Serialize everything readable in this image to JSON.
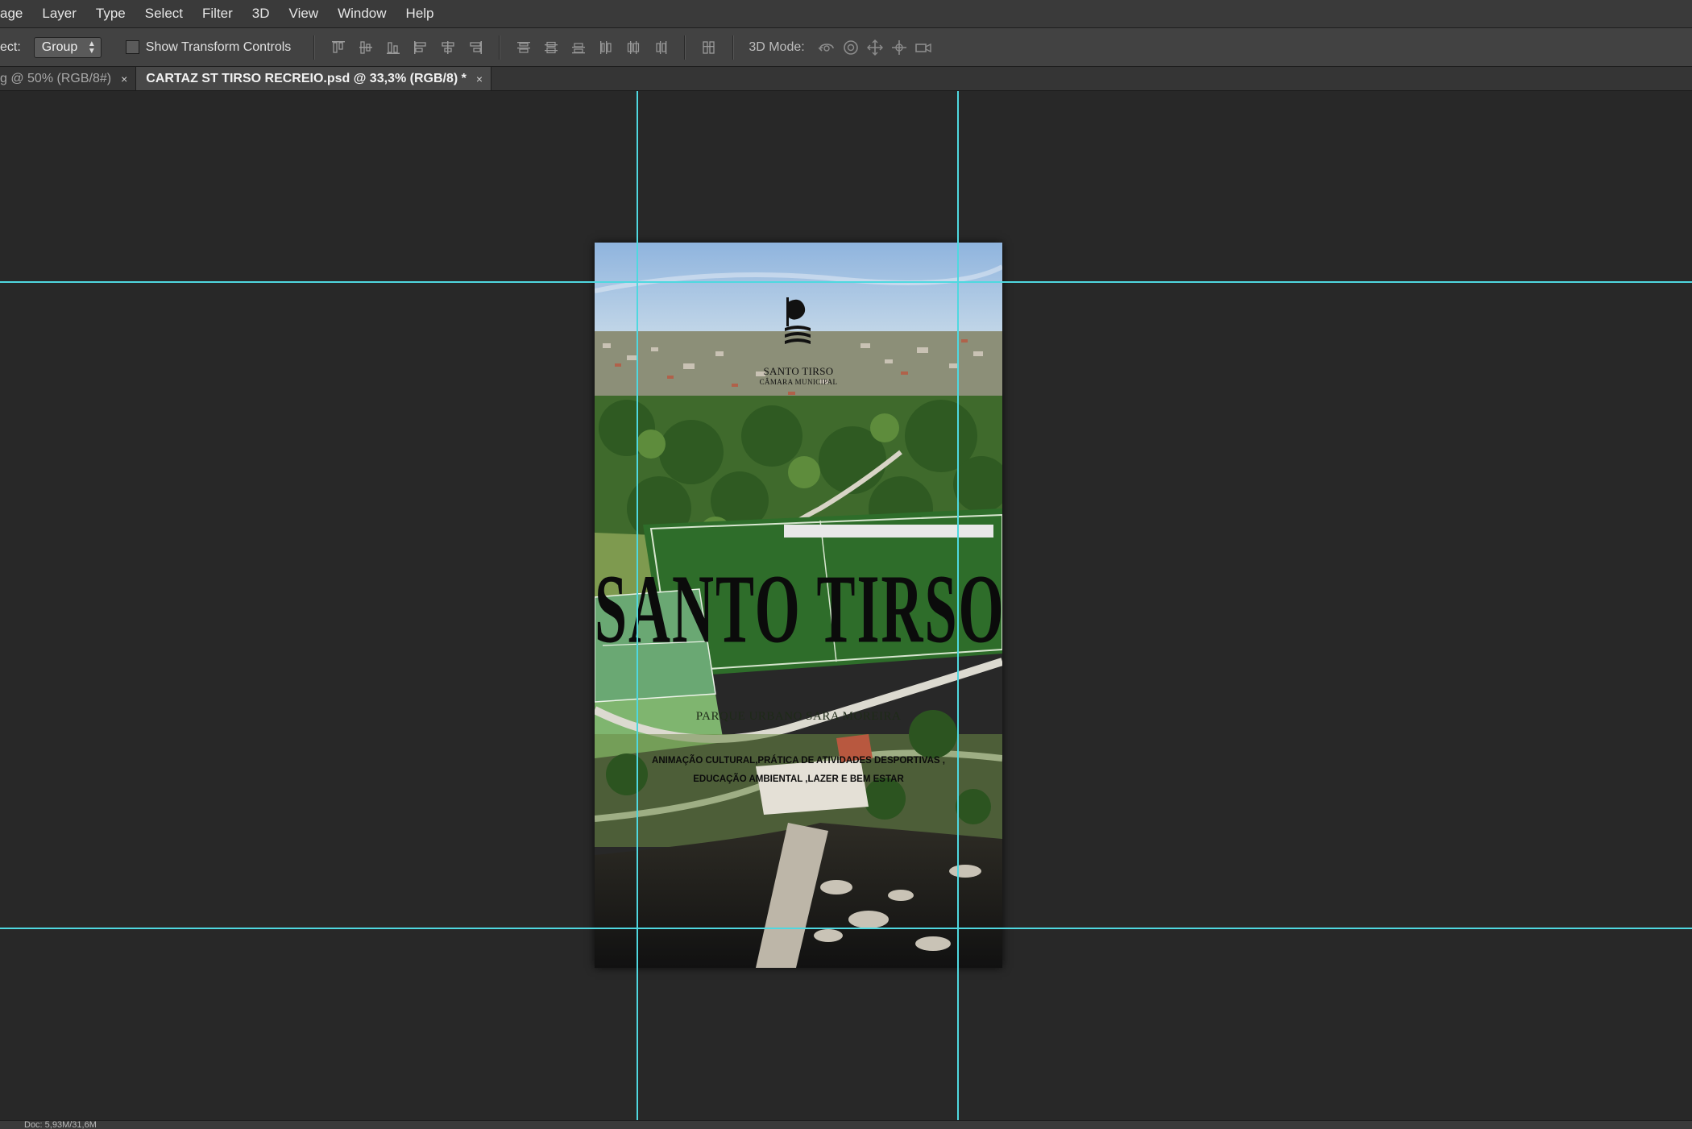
{
  "menu": {
    "items": [
      "age",
      "Layer",
      "Type",
      "Select",
      "Filter",
      "3D",
      "View",
      "Window",
      "Help"
    ]
  },
  "options_bar": {
    "select_label": "ect:",
    "select_value": "Group",
    "transform_label": "Show Transform Controls",
    "transform_checked": false,
    "mode_label": "3D Mode:"
  },
  "tabs": [
    {
      "title": "g @ 50% (RGB/8#)",
      "active": false,
      "close": "×"
    },
    {
      "title": "CARTAZ ST TIRSO RECREIO.psd @ 33,3% (RGB/8) *",
      "active": true,
      "close": "×"
    }
  ],
  "poster": {
    "brand_name": "SANTO TIRSO",
    "brand_sub": "CÂMARA MUNICIPAL",
    "title": "SANTO TIRSO",
    "subtitle": "PARQUE URBANO SARA MOREIRA",
    "description_line1": "ANIMAÇÃO CULTURAL,PRÁTICA DE ATIVIDADES DESPORTIVAS ,",
    "description_line2": "EDUCAÇÃO AMBIENTAL ,LAZER E BEM ESTAR"
  },
  "status_bar": {
    "text": "Doc: 5,93M/31,6M"
  },
  "colors": {
    "guide": "#4fd8e0",
    "workspace": "#282828",
    "menubar": "#3a3a3a",
    "optionsbar": "#424242"
  }
}
